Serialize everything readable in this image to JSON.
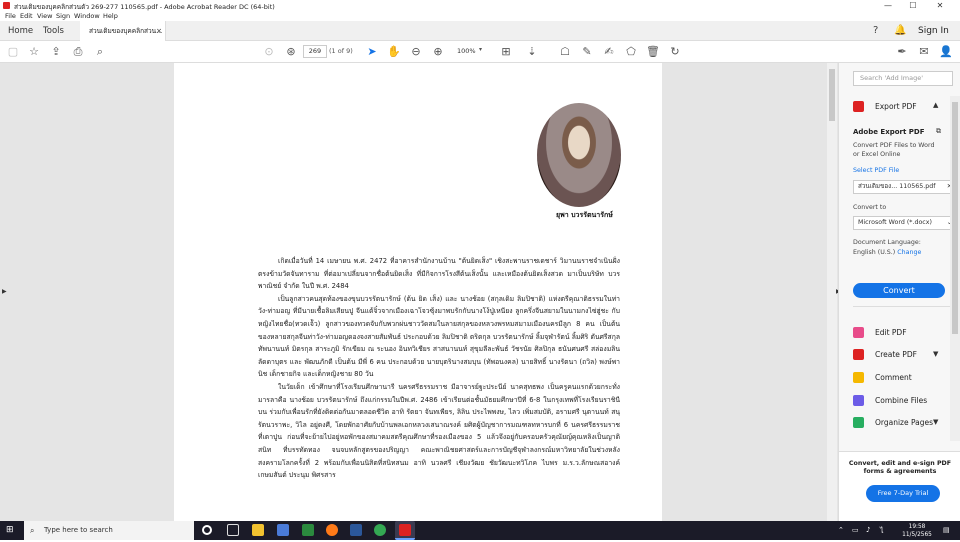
{
  "window": {
    "title": "ส่วนเติมของบุคคลิกส่วนตัว 269-277 110565.pdf - Adobe Acrobat Reader DC (64-bit)",
    "minimize_glyph": "—",
    "maximize_glyph": "☐",
    "close_glyph": "✕"
  },
  "menu": [
    "File",
    "Edit",
    "View",
    "Sign",
    "Window",
    "Help"
  ],
  "tabs": {
    "home": "Home",
    "tools": "Tools",
    "document": "ส่วนเติมของบุคคลิกส่วน...",
    "close": "×",
    "signin": "Sign In"
  },
  "toolbar": {
    "page_number": "269",
    "page_total": "(1 of 9)",
    "zoom": "100%",
    "zoom_dropdown": "▾"
  },
  "document": {
    "caption": "ยุพา บวรรัตนารักษ์",
    "paragraphs": [
      "เกิดเมื่อวันที่ 14 เมษายน พ.ศ. 2472 ที่อาคารสำนักงานบ้าน \"ต้นยิดเส็ง\" เชิงสะพานราชเดชาร์ วิมานนราชจำเนินฝั่งตรงข้ามวัดจันทาราม ที่ต่อมาเปลี่ยนจากชื่อต้นยิดเส็ง ที่มีกิจการโรงสีต้นเส็งนั้น และเหมืองต้นยิดเส็งสวด มาเป็นบริษัท บวรพาณิชย์ จำกัด ในปี พ.ศ. 2484",
      "เป็นลูกสาวคนสุดท้องของขุนบวรรัตนารักษ์ (ต้น ยิด เส็ง) และ นางช้อย (สกุลเดิม ลิมปิชาติ) แห่งตรีคุณาติธรรมในท่าวัง-ท่ามอญ ที่มีนายเชื้อลิมเสียนปู จีนแต้จิ๋วจากเมืองเฉาโจวซุ้งมาพบรักกับนางโง้ปู่เหนียง ลูกครึ่งจีนสยามในนามกงไซ่ฮู่ชะ กับหญิงไทยชื่อ(ทวดเจ้ัว) ลูกสาวของทวดจับกับพวกผ่นชาววัดสมในลายสกุลของหลวงพรหมสมามเมืองนครมีลูก 8 คน เป็นต้นของหลายสกุลจีนท่าวัง-ท่ามอญดองจงสายสัมพันธ์ ประกอบด้วย ลิมปิชาติ ตริตกุล บวรรัตนารักษ์ ลิ้มจุฬารัตน์ ลิ้มศิริ ตันศรีสกุล ทัพนานนท์ มิตรกุล สาระภูมิ รักเขียม ณ ระนอง อินทวิเชียร สาสนานนท์ สุขุมลีละพันธ์ วัชรนัย ศิลปิกุล ธนันศนศรี สล่องมลิน ลัดดาบุตร และ พัฒนภักดี เป็นต้น มีพี่ 6 คน ประกอบด้วย นายบุตรินางสมบุน (ทัพอนงคล) นายสิทธิ์ นางรัตนา (ถวิล) พงษ์พานิช เด็กชายกิจ และเด็กหญิงชาย 80 วัน",
      "ในวัยเด็ก เข้าศึกษาที่โรงเรียนศึกษานารี นครศรีธรรมราช มีอาจารย์ฐะประนีย์ นาคสุทธพง เป็นครูคนแรกด้วยกระทั่งมารลาคือ นางช้อย บวรรัตนารักษ์ ถึงแก่กรรมในปีพ.ศ. 2486 เข้าเรียนต่อชั้นมัธยมศึกษาปีที่ 6-8 ในกรุงเทพที่โรงเรียนราชินีบน ร่วมกับเพื่อนรักที่ยังติดต่อกันมาตลอดชีวิต อาทิ รัตยา จันทเพียร, ลิลิน ประไพพงษ, ไลว เพิ่มสมบัติ, อรามศรี นุตานนท์ สนุ รัตนวราพะ, วิไล อยู่ดงศี, โดยพักอาศัยกับบ้านพลเอกหลวงเสนาณรงค์ ยศิตผู้บัญชาการมณฑลทหารบกที่ 6 นครศรีธรรมราช ที่เตาปูน ก่อนที่จะย้ายไปอยู่หอพักของสมาคมสตรีคุณศึกษาที่รองเมืองของ 5 แล้วจึงอยู่กับครอบครัวคุณัยญ์คุณหลิงเป็นญาติสนิท ที่บรรทัดทอง จนจบหลักสูตรของปริญญา คณะพาณิชยศาสตร์และการบัญชีจุฬาลงกรณ์มหาวิทยาลัยในช่วงหลังสงครามโลกครั้งที่ 2 พร้อมกับเพื่อนนิสิตที่สนิทสนม อาทิ นวลศรี เชียงวัฒย ชัยวัฒนะทวิโภค ไบพร ม.ร.ว.ลักษณสอางค์ เกษมสันต์ ประนุม พิศรสาร"
    ]
  },
  "right_panel": {
    "search_placeholder": "Search 'Add Image'",
    "export_pdf": "Export PDF",
    "adobe_export_title": "Adobe Export PDF",
    "adobe_export_desc": "Convert PDF Files to Word or Excel Online",
    "select_file_label": "Select PDF File",
    "selected_file": "ส่วนเติมของ... 110565.pdf",
    "convert_to_label": "Convert to",
    "convert_to_value": "Microsoft Word (*.docx)",
    "doc_language_label": "Document Language:",
    "doc_language_value": "English (U.S.)",
    "change_link": "Change",
    "convert_button": "Convert",
    "tools": [
      "Edit PDF",
      "Create PDF",
      "Comment",
      "Combine Files",
      "Organize Pages"
    ],
    "promo_text": "Convert, edit and e-sign PDF forms & agreements",
    "promo_button": "Free 7-Day Trial"
  },
  "taskbar": {
    "search_placeholder": "Type here to search",
    "time": "19:58",
    "date": "11/5/2565"
  },
  "colors": {
    "accent": "#1473e6",
    "taskbar": "#1b1b28",
    "acrobat_red": "#d22222"
  }
}
